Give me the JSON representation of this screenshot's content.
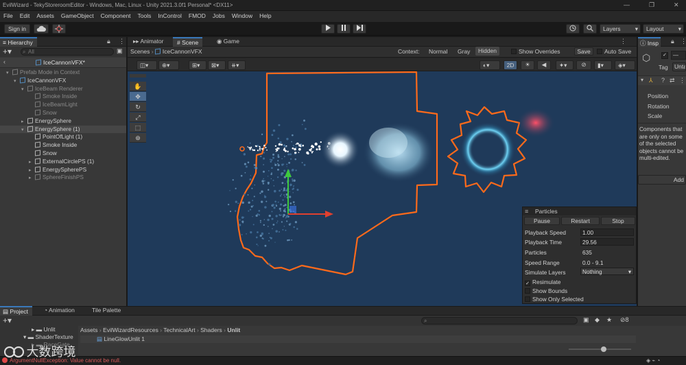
{
  "window": {
    "title": "EvilWizard - TekyStoreroomEditor - Windows, Mac, Linux - Unity 2021.3.0f1 Personal* <DX11>",
    "controls": [
      "—",
      "❐",
      "✕"
    ]
  },
  "menu": [
    "File",
    "Edit",
    "Assets",
    "GameObject",
    "Component",
    "Tools",
    "InControl",
    "FMOD",
    "Jobs",
    "Window",
    "Help"
  ],
  "toolbar": {
    "sign_in": "Sign in",
    "layers": "Layers",
    "layout": "Layout"
  },
  "hierarchy": {
    "tab": "Hierarchy",
    "search_placeholder": "All",
    "prefab_title": "IceCannonVFX*",
    "rows": [
      {
        "label": "Prefab Mode in Context",
        "indent": 1,
        "dim": true,
        "selected": false
      },
      {
        "label": "IceCannonVFX",
        "indent": 2,
        "dim": false,
        "selected": false
      },
      {
        "label": "IceBeam Renderer",
        "indent": 3,
        "dim": true,
        "selected": false
      },
      {
        "label": "Smoke Inside",
        "indent": 4,
        "dim": true,
        "selected": false
      },
      {
        "label": "IceBeamLight",
        "indent": 4,
        "dim": true,
        "selected": false
      },
      {
        "label": "Snow",
        "indent": 4,
        "dim": true,
        "selected": false
      },
      {
        "label": "EnergySphere",
        "indent": 3,
        "dim": false,
        "selected": false
      },
      {
        "label": "EnergySphere (1)",
        "indent": 3,
        "dim": false,
        "selected": true
      },
      {
        "label": "PointOfLight (1)",
        "indent": 4,
        "dim": false,
        "selected": false
      },
      {
        "label": "Smoke Inside",
        "indent": 4,
        "dim": false,
        "selected": false
      },
      {
        "label": "Snow",
        "indent": 4,
        "dim": false,
        "selected": false
      },
      {
        "label": "ExternalCirclePS (1)",
        "indent": 4,
        "dim": false,
        "selected": false
      },
      {
        "label": "EnergySpherePS",
        "indent": 4,
        "dim": false,
        "selected": false
      },
      {
        "label": "SphereFinishPS",
        "indent": 4,
        "dim": true,
        "selected": false
      }
    ]
  },
  "scene": {
    "tabs": [
      "Animator",
      "Scene",
      "Game"
    ],
    "breadcrumb_root": "Scenes",
    "breadcrumb_current": "IceCannonVFX",
    "context_label": "Context:",
    "context_options": [
      "Normal",
      "Gray",
      "Hidden"
    ],
    "show_overrides": "Show Overrides",
    "save": "Save",
    "auto_save": "Auto Save",
    "mode_2d": "2D"
  },
  "particles": {
    "title": "Particles",
    "buttons": [
      "Pause",
      "Restart",
      "Stop"
    ],
    "fields": [
      {
        "label": "Playback Speed",
        "value": "1.00"
      },
      {
        "label": "Playback Time",
        "value": "29.56"
      },
      {
        "label": "Particles",
        "value": "635"
      },
      {
        "label": "Speed Range",
        "value": "0.0 - 9.1"
      },
      {
        "label": "Simulate Layers",
        "value": "Nothing"
      }
    ],
    "checks": [
      {
        "label": "Resimulate",
        "checked": true
      },
      {
        "label": "Show Bounds",
        "checked": false
      },
      {
        "label": "Show Only Selected",
        "checked": false
      }
    ]
  },
  "inspector": {
    "tab": "Insp",
    "tag_label": "Tag",
    "tag_value": "Unta",
    "transform": [
      "Position",
      "Rotation",
      "Scale"
    ],
    "multi_note": "Components that are only on some of the selected objects cannot be multi-edited.",
    "add_button": "Add"
  },
  "project": {
    "tabs": [
      "Project",
      "Animation",
      "Tile Palette"
    ],
    "tree": [
      "Unlit",
      "ShaderTexture",
      "RaceGate"
    ],
    "path": [
      "Assets",
      "EvilWizardResources",
      "TechnicalArt",
      "Shaders",
      "Unlit"
    ],
    "files": [
      "LineGlowUnlit 1"
    ],
    "hidden_count": "8"
  },
  "status": {
    "error": "ArgumentNullException: Value cannot be null."
  },
  "watermark": "大数跨境",
  "colors": {
    "accent": "#3a79bb",
    "selection_outline": "#ff6a1a",
    "scene_bg": "#1f3a5a",
    "error": "#e04848"
  }
}
